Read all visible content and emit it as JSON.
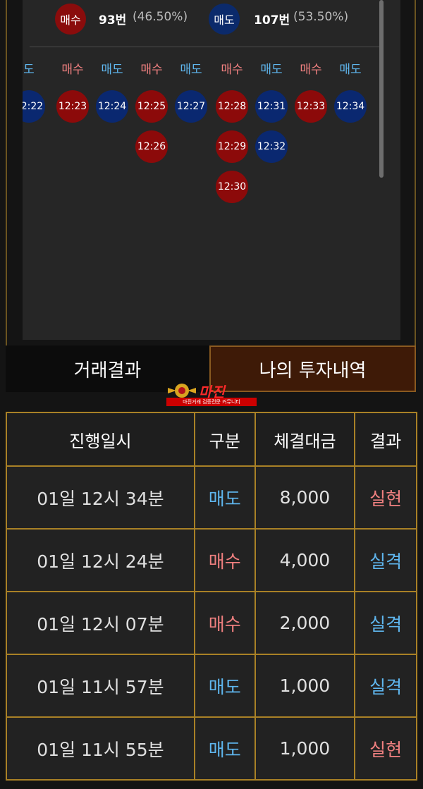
{
  "summary": {
    "buy_label": "매수",
    "buy_count": "93번",
    "buy_pct": "(46.50%)",
    "sell_label": "매도",
    "sell_count": "107번",
    "sell_pct": "(53.50%)"
  },
  "columns": [
    {
      "label": "도",
      "kind": "sell",
      "dots": [
        "12:22"
      ]
    },
    {
      "label": "매수",
      "kind": "buy",
      "dots": [
        "12:23"
      ]
    },
    {
      "label": "매도",
      "kind": "sell",
      "dots": [
        "12:24"
      ]
    },
    {
      "label": "매수",
      "kind": "buy",
      "dots": [
        "12:25",
        "12:26"
      ]
    },
    {
      "label": "매도",
      "kind": "sell",
      "dots": [
        "12:27"
      ]
    },
    {
      "label": "매수",
      "kind": "buy",
      "dots": [
        "12:28",
        "12:29",
        "12:30"
      ]
    },
    {
      "label": "매도",
      "kind": "sell",
      "dots": [
        "12:31",
        "12:32"
      ]
    },
    {
      "label": "매수",
      "kind": "buy",
      "dots": [
        "12:33"
      ]
    },
    {
      "label": "매도",
      "kind": "sell",
      "dots": [
        "12:34"
      ]
    }
  ],
  "tabs": {
    "left": "거래결과",
    "right": "나의 투자내역"
  },
  "logo": {
    "text": "마진",
    "sub": "마진거래 검증전문 커뮤니티"
  },
  "table": {
    "headers": [
      "진행일시",
      "구분",
      "체결대금",
      "결과"
    ],
    "rows": [
      {
        "time": "01일 12시 34분",
        "type": "매도",
        "amount": "8,000",
        "result": "실현"
      },
      {
        "time": "01일 12시 24분",
        "type": "매수",
        "amount": "4,000",
        "result": "실격"
      },
      {
        "time": "01일 12시 07분",
        "type": "매수",
        "amount": "2,000",
        "result": "실격"
      },
      {
        "time": "01일 11시 57분",
        "type": "매도",
        "amount": "1,000",
        "result": "실격"
      },
      {
        "time": "01일 11시 55분",
        "type": "매도",
        "amount": "1,000",
        "result": "실현"
      }
    ]
  }
}
